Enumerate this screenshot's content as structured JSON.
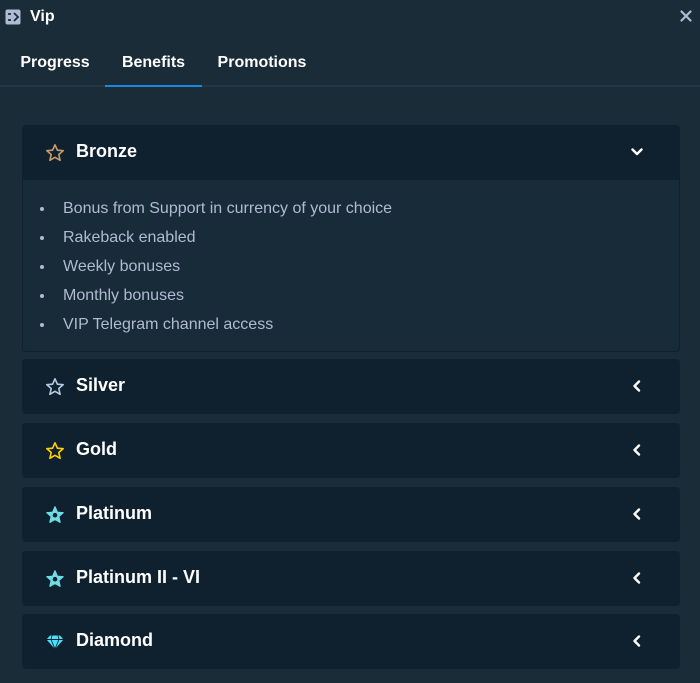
{
  "window": {
    "title": "Vip",
    "icon": "vip-icon",
    "close_icon": "close-icon"
  },
  "tabs": [
    {
      "label": "Progress",
      "active": false
    },
    {
      "label": "Benefits",
      "active": true
    },
    {
      "label": "Promotions",
      "active": false
    }
  ],
  "colors": {
    "background": "#1a2c38",
    "card": "#0f212e",
    "accent": "#1f85e0",
    "muted_text": "#b1bad3",
    "bronze": "#c69c6d",
    "silver": "#b2cce4",
    "gold": "#fed100",
    "platinum": "#6fdde7",
    "diamond": "#48e1ff"
  },
  "tiers": [
    {
      "name": "Bronze",
      "icon": "star-outline-icon",
      "expanded": true,
      "benefits": [
        "Bonus from Support in currency of your choice",
        "Rakeback enabled",
        "Weekly bonuses",
        "Monthly bonuses",
        "VIP Telegram channel access"
      ]
    },
    {
      "name": "Silver",
      "icon": "star-outline-icon",
      "expanded": false
    },
    {
      "name": "Gold",
      "icon": "star-outline-icon",
      "expanded": false
    },
    {
      "name": "Platinum",
      "icon": "star-badge-icon",
      "expanded": false
    },
    {
      "name": "Platinum II - VI",
      "icon": "star-badge-icon",
      "expanded": false
    },
    {
      "name": "Diamond",
      "icon": "diamond-icon",
      "expanded": false
    }
  ]
}
